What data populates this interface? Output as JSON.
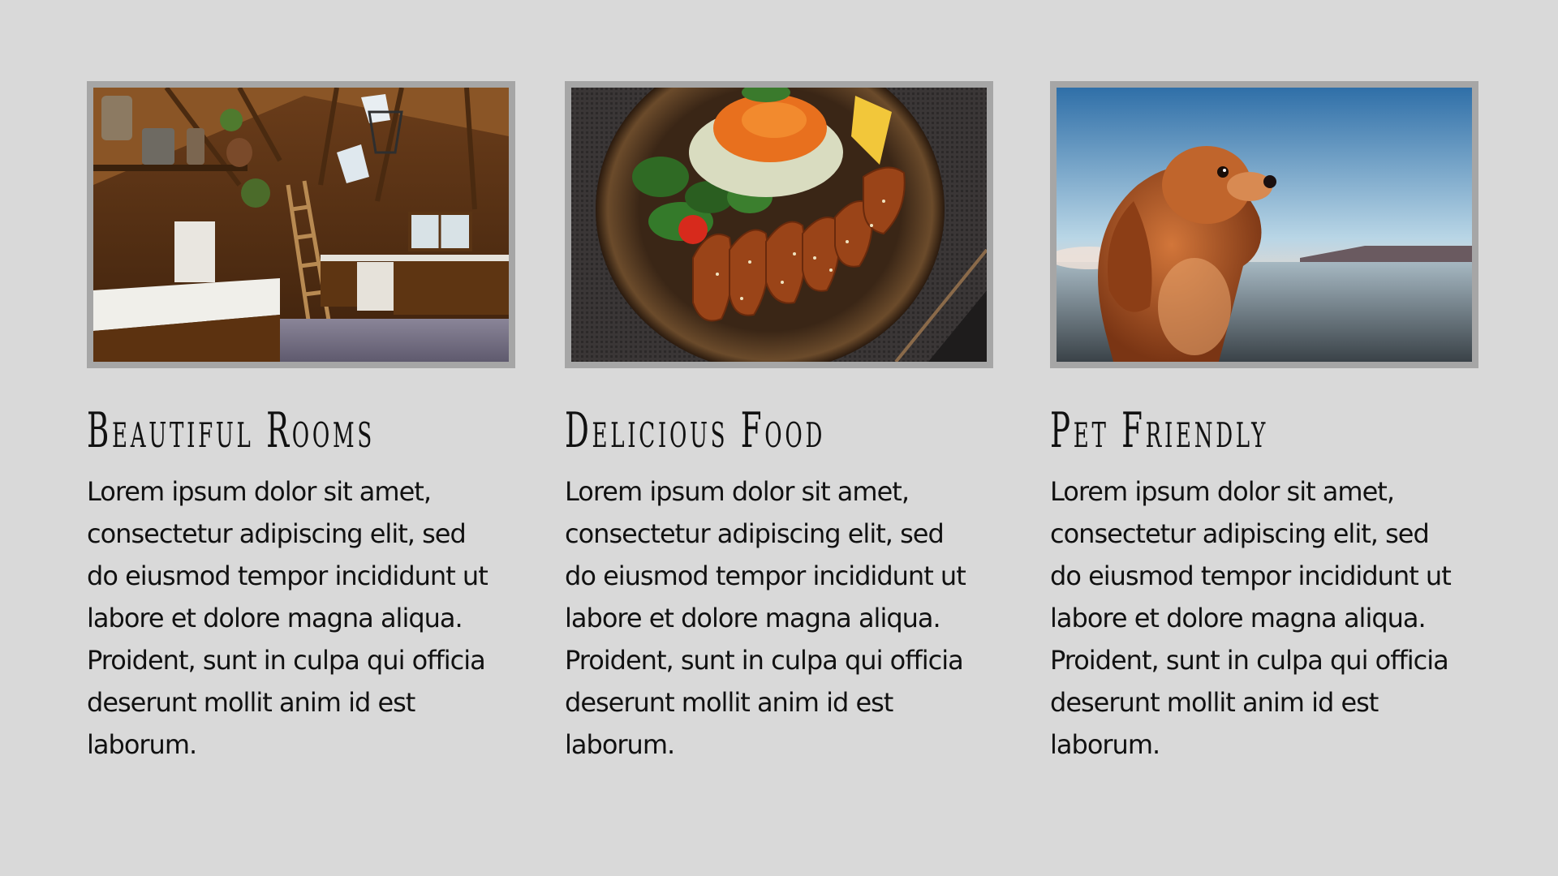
{
  "cards": [
    {
      "image": "rustic-kitchen-photo",
      "title": "Beautiful Rooms",
      "body": "Lorem ipsum dolor sit amet, consectetur adipiscing elit, sed do eiusmod tempor incididunt ut labore et dolore magna aliqua. Proident, sunt in culpa qui officia deserunt mollit anim id est laborum."
    },
    {
      "image": "grilled-chicken-salad-photo",
      "title": "Delicious Food",
      "body": "Lorem ipsum dolor sit amet, consectetur adipiscing elit, sed do eiusmod tempor incididunt ut labore et dolore magna aliqua. Proident, sunt in culpa qui officia deserunt mollit anim id est laborum."
    },
    {
      "image": "dog-at-beach-photo",
      "title": "Pet Friendly",
      "body": "Lorem ipsum dolor sit amet, consectetur adipiscing elit, sed do eiusmod tempor incididunt ut labore et dolore magna aliqua. Proident, sunt in culpa qui officia deserunt mollit anim id est laborum."
    }
  ],
  "colors": {
    "background": "#d9d9d9",
    "frame": "#a6a6a6",
    "text": "#111111"
  }
}
